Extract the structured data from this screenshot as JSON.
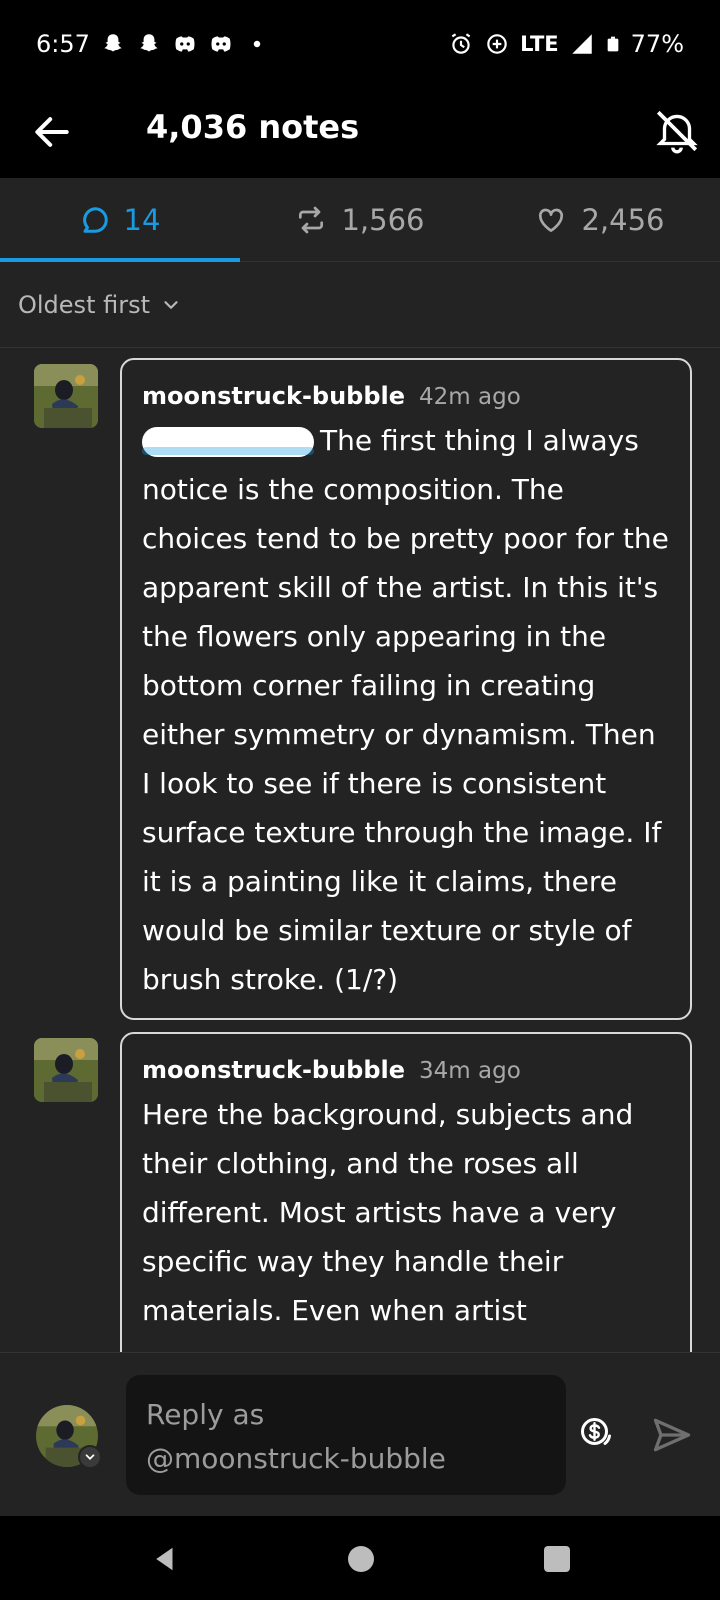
{
  "status_bar": {
    "time": "6:57",
    "network": "LTE",
    "battery": "77%",
    "icons": [
      "snapchat-icon",
      "snapchat-icon",
      "discord-icon",
      "discord-icon",
      "dot-icon",
      "alarm-icon",
      "data-saver-icon",
      "signal-icon",
      "battery-icon"
    ]
  },
  "header": {
    "title": "4,036 notes"
  },
  "tabs": [
    {
      "label": "14",
      "icon": "comment-icon",
      "active": true
    },
    {
      "label": "1,566",
      "icon": "reblog-icon",
      "active": false
    },
    {
      "label": "2,456",
      "icon": "heart-icon",
      "active": false
    }
  ],
  "sort": {
    "label": "Oldest first"
  },
  "notes": [
    {
      "author": "moonstruck-bubble",
      "time": "42m ago",
      "text": "The first thing I always notice is the composition. The choices tend to be pretty poor for the apparent skill of the artist. In this it's the flowers only appearing in the bottom corner failing in creating either symmetry or dynamism. Then I look to see if there is consistent surface texture through the image. If it is a painting like it claims, there would be similar texture or style of brush stroke. (1/?)"
    },
    {
      "author": "moonstruck-bubble",
      "time": "34m ago",
      "text": "Here the background, subjects and their clothing,  and the roses all different. Most artists have a very specific way they handle their materials. Even when artist"
    }
  ],
  "reply": {
    "placeholder_line1": "Reply as",
    "placeholder_line2": "@moonstruck-bubble"
  },
  "colors": {
    "accent": "#199be2",
    "background": "#232323",
    "bar": "#000000"
  }
}
